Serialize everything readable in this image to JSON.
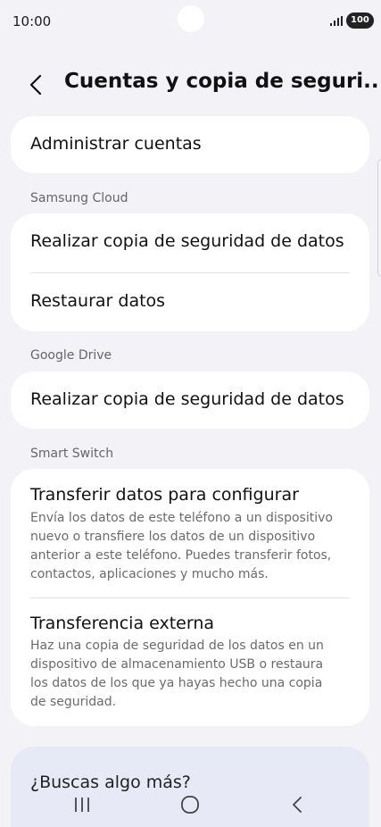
{
  "status_bar": {
    "time": "10:00",
    "battery": "100"
  },
  "header": {
    "title": "Cuentas y copia de seguri..."
  },
  "items": {
    "manage_accounts": "Administrar cuentas",
    "samsung_backup": "Realizar copia de seguridad de datos",
    "samsung_restore": "Restaurar datos",
    "google_backup": "Realizar copia de seguridad de datos"
  },
  "sections": {
    "samsung_cloud": "Samsung Cloud",
    "google_drive": "Google Drive",
    "smart_switch": "Smart Switch"
  },
  "smart_switch": {
    "transfer_title": "Transferir datos para configurar",
    "transfer_desc": "Envía los datos de este teléfono a un dispositivo nuevo o transfiere los datos de un dispositivo anterior a este teléfono. Puedes transferir fotos, contactos, aplicaciones y mucho más.",
    "external_title": "Transferencia externa",
    "external_desc": "Haz una copia de seguridad de los datos en un dispositivo de almacenamiento USB o restaura los datos de los que ya hayas hecho una copia de seguridad."
  },
  "search_card": {
    "label": "¿Buscas algo más?"
  },
  "icons": {
    "back": "chevron-left-icon",
    "nav_recent": "recent-apps-icon",
    "nav_home": "home-icon",
    "nav_back": "back-icon"
  }
}
